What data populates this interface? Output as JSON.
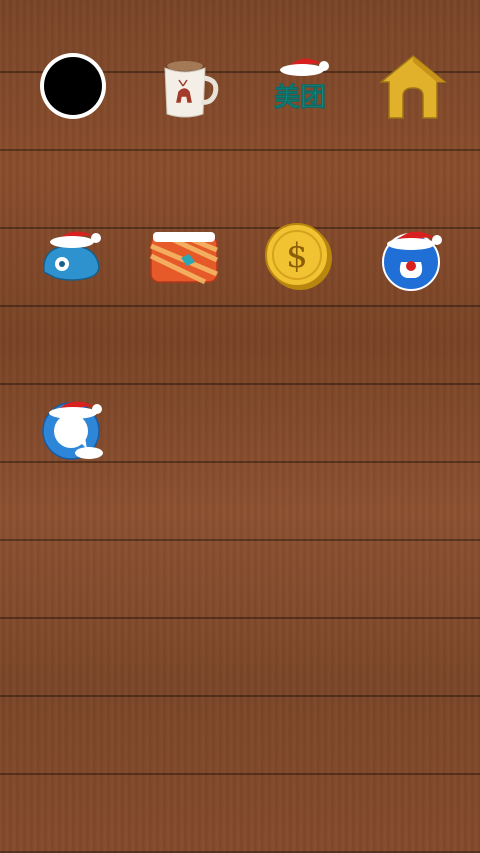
{
  "screen": {
    "background": "wood-planks",
    "apps": [
      {
        "name": "black-circle-app",
        "icon": "black-circle-icon",
        "label": ""
      },
      {
        "name": "coffee-mug-app",
        "icon": "reindeer-mug-icon",
        "label": ""
      },
      {
        "name": "meituan-app",
        "icon": "meituan-santa-hat-icon",
        "label": "美团"
      },
      {
        "name": "home-app",
        "icon": "golden-house-icon",
        "label": ""
      },
      {
        "name": "blue-bird-app",
        "icon": "blue-bird-santa-hat-icon",
        "label": ""
      },
      {
        "name": "gift-wallet-app",
        "icon": "christmas-wallet-icon",
        "label": ""
      },
      {
        "name": "gold-coin-app",
        "icon": "dollar-coin-icon",
        "label": "$"
      },
      {
        "name": "snowman-app",
        "icon": "blue-mascot-santa-hat-icon",
        "label": ""
      },
      {
        "name": "chat-bubble-app",
        "icon": "chat-bubble-santa-hat-icon",
        "label": ""
      }
    ]
  },
  "colors": {
    "wood": "#7b4528",
    "santa_red": "#d8201e",
    "gold": "#e2b12c",
    "teal": "#1aa39a",
    "blue": "#1f6fd6"
  }
}
